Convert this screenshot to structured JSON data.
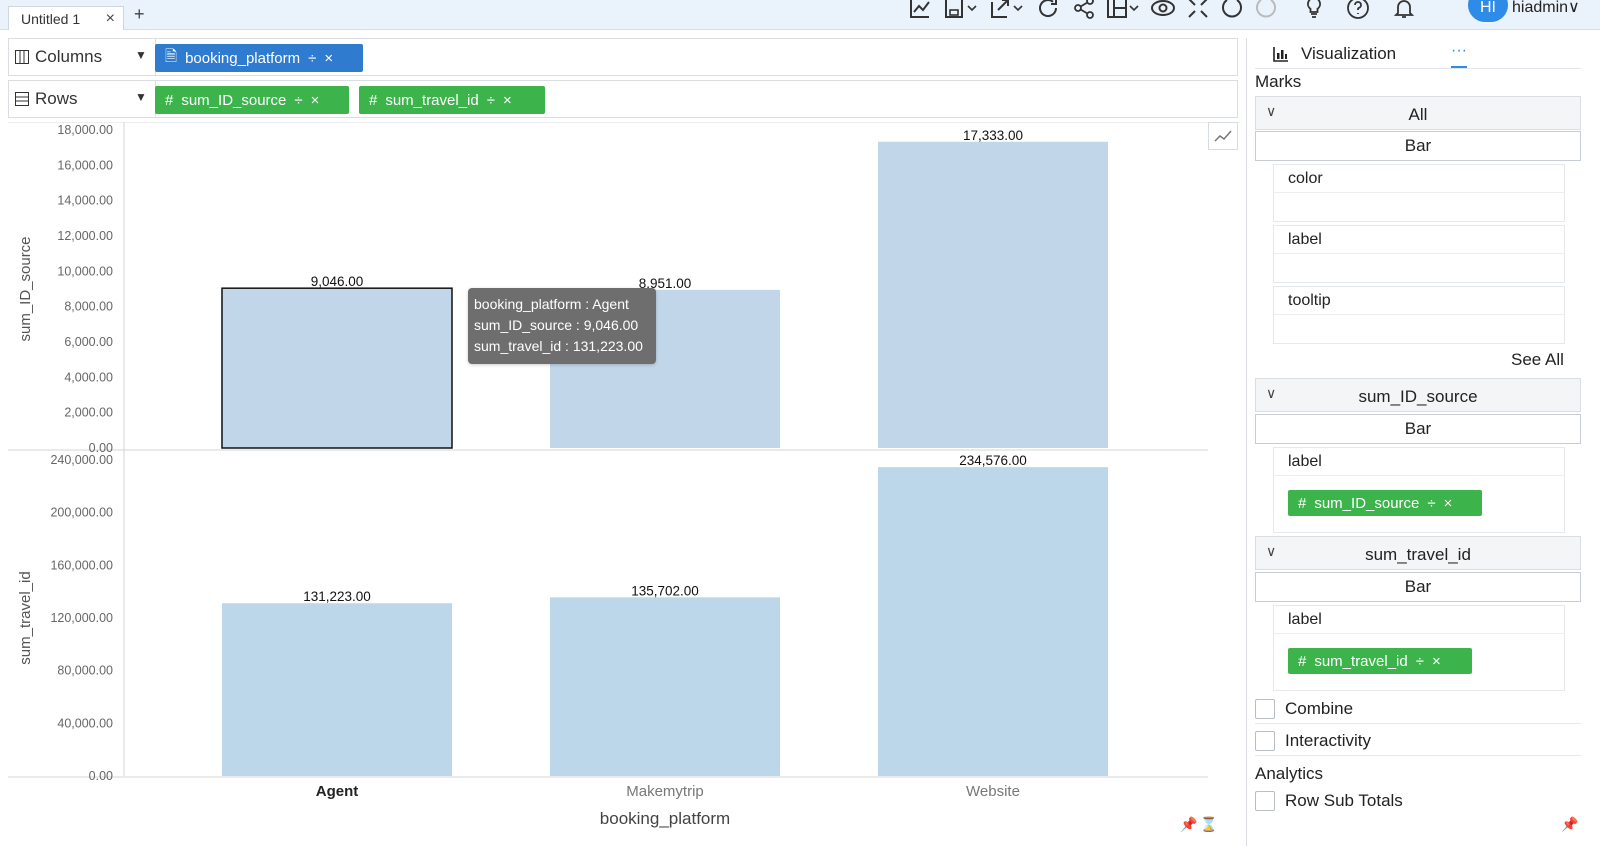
{
  "tabs": [
    {
      "label": "Untitled 1",
      "close": "×"
    }
  ],
  "tab_add": "+",
  "user": {
    "initials": "HI",
    "name": "hiadmin∨"
  },
  "shelves": {
    "columns": {
      "label": "Columns",
      "pills": [
        {
          "icon": "🗎",
          "label": "booking_platform",
          "sort": "÷",
          "remove": "×"
        }
      ]
    },
    "rows": {
      "label": "Rows",
      "pills": [
        {
          "icon": "#",
          "label": "sum_ID_source",
          "sort": "÷",
          "remove": "×"
        },
        {
          "icon": "#",
          "label": "sum_travel_id",
          "sort": "÷",
          "remove": "×"
        }
      ]
    }
  },
  "tooltip": {
    "line1": "booking_platform : Agent",
    "line2": "sum_ID_source : 9,046.00",
    "line3": "sum_travel_id : 131,223.00"
  },
  "colors": {
    "bar": "#c2d6ea",
    "bar2": "#bdd7ea",
    "blue": "#2e7bcf",
    "green": "#3cb44b"
  },
  "chart_data": [
    {
      "type": "bar",
      "categories": [
        "Agent",
        "Makemytrip",
        "Website"
      ],
      "values": [
        9046,
        8951,
        17333
      ],
      "data_labels": [
        "9,046.00",
        "8,951.00",
        "17,333.00"
      ],
      "ylabel": "sum_ID_source",
      "ylim": [
        0,
        18000
      ],
      "yticks": [
        "0.00",
        "2,000.00",
        "4,000.00",
        "6,000.00",
        "8,000.00",
        "10,000.00",
        "12,000.00",
        "14,000.00",
        "16,000.00",
        "18,000.00"
      ],
      "highlighted_category": "Agent"
    },
    {
      "type": "bar",
      "categories": [
        "Agent",
        "Makemytrip",
        "Website"
      ],
      "values": [
        131223,
        135702,
        234576
      ],
      "data_labels": [
        "131,223.00",
        "135,702.00",
        "234,576.00"
      ],
      "ylabel": "sum_travel_id",
      "xlabel": "booking_platform",
      "ylim": [
        0,
        240000
      ],
      "yticks": [
        "0.00",
        "40,000.00",
        "80,000.00",
        "120,000.00",
        "160,000.00",
        "200,000.00",
        "240,000.00"
      ]
    }
  ],
  "panel": {
    "title": "Visualization",
    "dots": "···",
    "marks_label": "Marks",
    "groups": [
      {
        "title": "All",
        "mark": "Bar",
        "props": [
          "color",
          "label",
          "tooltip"
        ]
      },
      {
        "title": "sum_ID_source",
        "mark": "Bar",
        "prop": "label",
        "pill": "sum_ID_source"
      },
      {
        "title": "sum_travel_id",
        "mark": "Bar",
        "prop": "label",
        "pill": "sum_travel_id"
      }
    ],
    "see_all": "See All",
    "combine": "Combine",
    "interactivity": "Interactivity",
    "analytics": "Analytics",
    "row_sub_totals": "Row Sub Totals"
  }
}
